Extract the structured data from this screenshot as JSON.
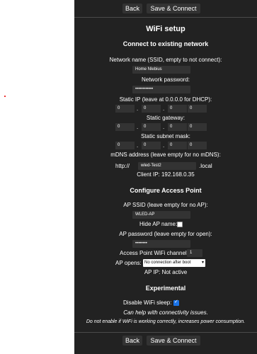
{
  "top_buttons": {
    "back": "Back",
    "save": "Save & Connect"
  },
  "title": "WiFi setup",
  "connect_section": {
    "heading": "Connect to existing network",
    "ssid_label": "Network name (SSID, empty to not connect):",
    "ssid_value": "Home Nlebius",
    "password_label": "Network password:",
    "password_value": "••••••••••••",
    "static_ip_label": "Static IP (leave at 0.0.0.0 for DHCP):",
    "static_ip": [
      "0",
      "0",
      "0",
      "0"
    ],
    "gateway_label": "Static gateway:",
    "gateway": [
      "0",
      "0",
      "0",
      "0"
    ],
    "subnet_label": "Static subnet mask:",
    "subnet": [
      "0",
      "0",
      "0",
      "0"
    ],
    "mdns_label": "mDNS address (leave empty for no mDNS):",
    "mdns_prefix": "http://",
    "mdns_value": "wled-Test2",
    "mdns_suffix": ".local",
    "client_ip": "Client IP: 192.168.0.35"
  },
  "ap_section": {
    "heading": "Configure Access Point",
    "ssid_label": "AP SSID (leave empty for no AP):",
    "ssid_value": "WLED-AP",
    "hide_label": "Hide AP name:",
    "hide_checked": false,
    "password_label": "AP password (leave empty for open):",
    "password_value": "••••••••",
    "channel_label": "Access Point WiFi channel:",
    "channel_value": "1",
    "opens_label": "AP opens:",
    "opens_value": "No connection after boot",
    "ap_ip": "AP IP: Not active"
  },
  "experimental": {
    "heading": "Experimental",
    "sleep_label": "Disable WiFi sleep:",
    "sleep_checked": true,
    "note1": "Can help with connectivity issues.",
    "note2": "Do not enable if WiFi is working correctly, increases power consumption."
  },
  "bottom_buttons": {
    "back": "Back",
    "save": "Save & Connect"
  },
  "colors": {
    "page_bg": "#222222",
    "input_bg": "#333333",
    "checkbox_accent": "#1a73e8",
    "outer_bg": "#ffffff"
  }
}
